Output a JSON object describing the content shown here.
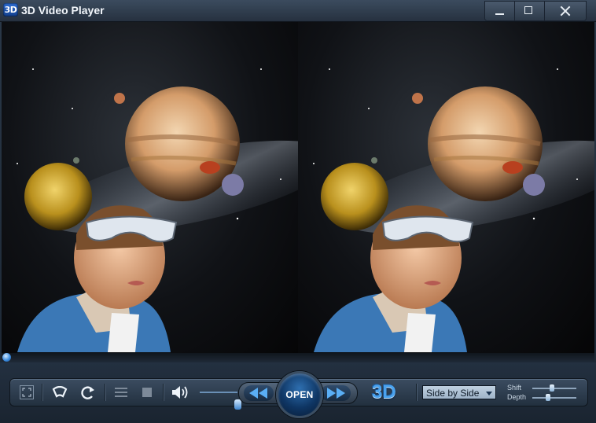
{
  "window": {
    "icon_text": "3D",
    "title": "3D Video Player",
    "buttons": [
      "minimize-icon",
      "maximize-icon",
      "close-icon"
    ]
  },
  "video": {
    "mode": "side-by-side",
    "panes": [
      "left-eye",
      "right-eye"
    ]
  },
  "playback": {
    "progress": 0.0
  },
  "controls": {
    "icons": [
      "fullscreen-icon",
      "headphones-icon",
      "repeat-icon",
      "playlist-icon",
      "stop-icon",
      "volume-icon",
      "rewind-icon",
      "fast-forward-icon"
    ],
    "volume": 1.0,
    "open_label": "OPEN",
    "logo_text": "3D",
    "display_mode": {
      "selected": "Side by Side"
    },
    "shift": {
      "label": "Shift",
      "value": 0.45
    },
    "depth": {
      "label": "Depth",
      "value": 0.35
    }
  },
  "colors": {
    "accent": "#4aa2ee",
    "titlebar": "#2f3c4c",
    "controlbar": "#1f2a37"
  }
}
